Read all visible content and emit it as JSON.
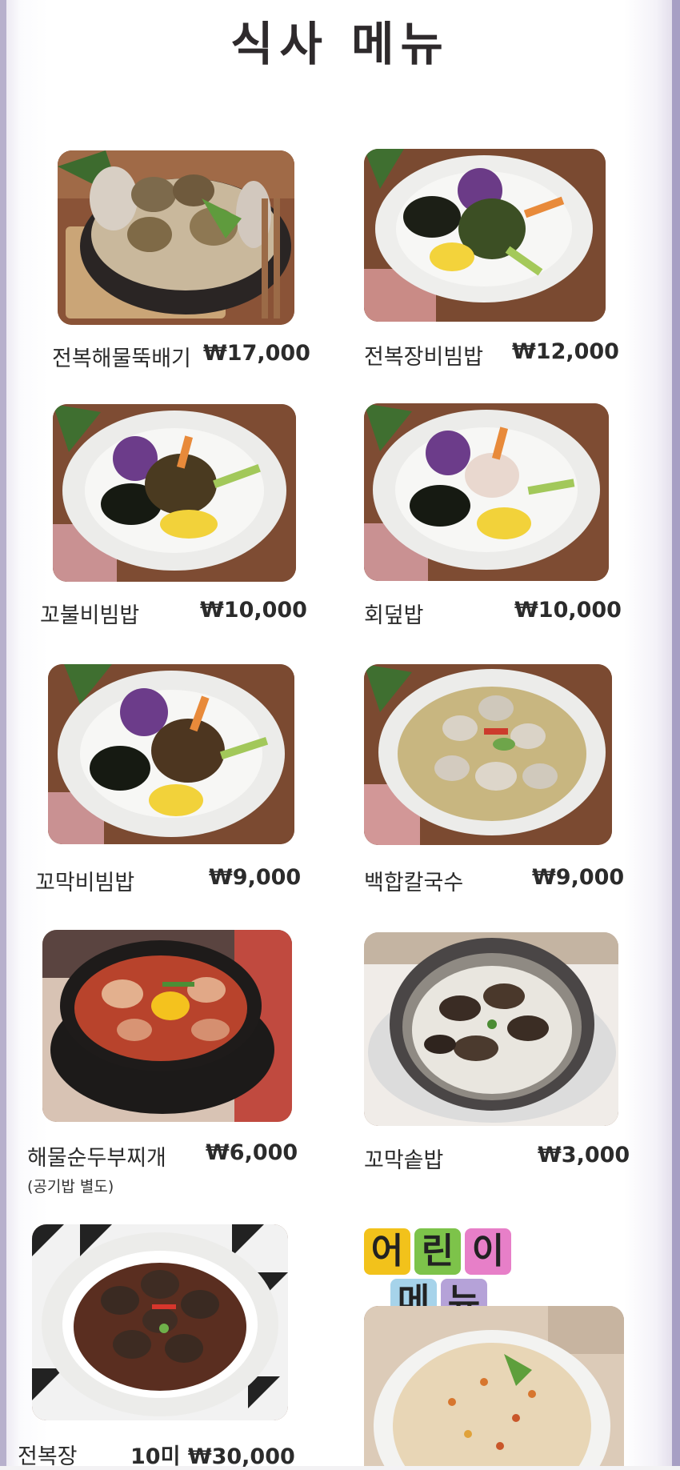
{
  "title": "식사 메뉴",
  "currency_symbol": "₩",
  "items": [
    {
      "name": "전복해물뚝배기",
      "price": "₩17,000"
    },
    {
      "name": "전복장비빔밥",
      "price": "₩12,000"
    },
    {
      "name": "꼬불비빔밥",
      "price": "₩10,000"
    },
    {
      "name": "회덮밥",
      "price": "₩10,000"
    },
    {
      "name": "꼬막비빔밥",
      "price": "₩9,000"
    },
    {
      "name": "백합칼국수",
      "price": "₩9,000"
    },
    {
      "name": "해물순두부찌개",
      "price": "₩6,000",
      "note": "(공기밥 별도)"
    },
    {
      "name": "꼬막솥밥",
      "price": "₩3,000"
    },
    {
      "name": "전복장",
      "price": "10미 ₩30,000"
    }
  ],
  "kids_menu": {
    "chars": [
      "어",
      "린",
      "이",
      "메",
      "뉴"
    ],
    "colors": [
      "#f2c21b",
      "#7dc34a",
      "#e77fc8",
      "#a6d3ea",
      "#b5a2d8"
    ]
  },
  "colors": {
    "text": "#2b2b2b",
    "border_left": "#b7b0cc",
    "border_right": "#a79fc4",
    "wood": "#7b4a32"
  }
}
